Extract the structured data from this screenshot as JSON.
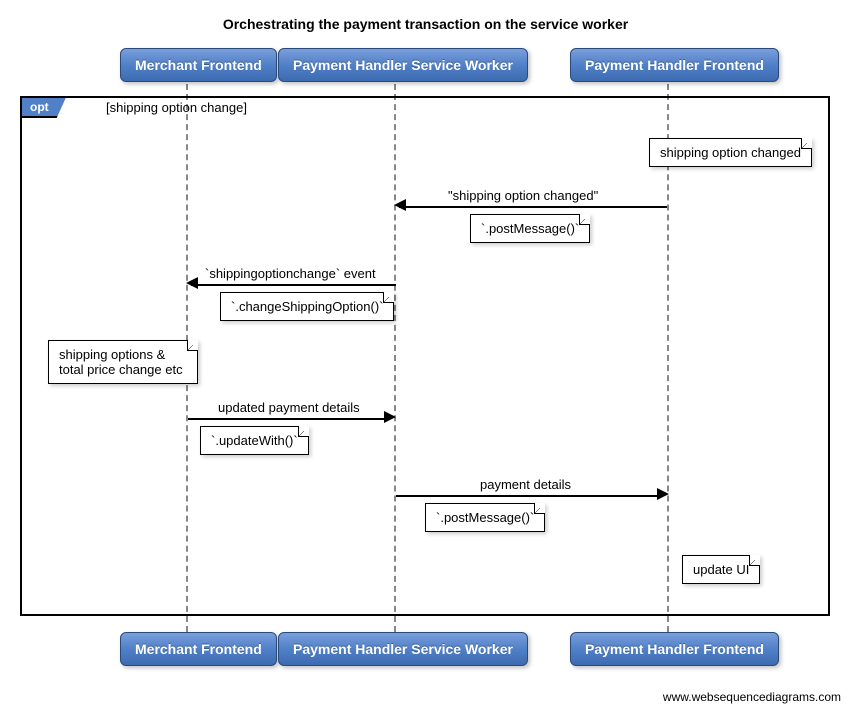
{
  "title": "Orchestrating the payment transaction on the service worker",
  "participants": {
    "p1": "Merchant Frontend",
    "p2": "Payment Handler Service Worker",
    "p3": "Payment Handler Frontend"
  },
  "frame": {
    "operator": "opt",
    "condition": "[shipping option change]"
  },
  "notes": {
    "n1": "shipping option changed",
    "n2": "`.postMessage()`",
    "n3": "`.changeShippingOption()`",
    "n4_line1": "shipping options &",
    "n4_line2": "total price change etc",
    "n5": "`.updateWith()`",
    "n6": "`.postMessage()`",
    "n7": "update UI"
  },
  "messages": {
    "m1": "\"shipping option changed\"",
    "m2": "`shippingoptionchange` event",
    "m3": "updated payment details",
    "m4": "payment details"
  },
  "watermark": "www.websequencediagrams.com",
  "chart_data": {
    "type": "sequence-diagram",
    "title": "Orchestrating the payment transaction on the service worker",
    "participants": [
      "Merchant Frontend",
      "Payment Handler Service Worker",
      "Payment Handler Frontend"
    ],
    "fragment": {
      "type": "opt",
      "guard": "shipping option change",
      "steps": [
        {
          "kind": "note",
          "over": "Payment Handler Frontend",
          "text": "shipping option changed"
        },
        {
          "kind": "message",
          "from": "Payment Handler Frontend",
          "to": "Payment Handler Service Worker",
          "label": "\"shipping option changed\"",
          "note": "`.postMessage()`"
        },
        {
          "kind": "message",
          "from": "Payment Handler Service Worker",
          "to": "Merchant Frontend",
          "label": "`shippingoptionchange` event",
          "note": "`.changeShippingOption()`"
        },
        {
          "kind": "note",
          "over": "Merchant Frontend",
          "text": "shipping options & total price change etc"
        },
        {
          "kind": "message",
          "from": "Merchant Frontend",
          "to": "Payment Handler Service Worker",
          "label": "updated payment details",
          "note": "`.updateWith()`"
        },
        {
          "kind": "message",
          "from": "Payment Handler Service Worker",
          "to": "Payment Handler Frontend",
          "label": "payment details",
          "note": "`.postMessage()`"
        },
        {
          "kind": "note",
          "over": "Payment Handler Frontend",
          "text": "update UI"
        }
      ]
    }
  }
}
